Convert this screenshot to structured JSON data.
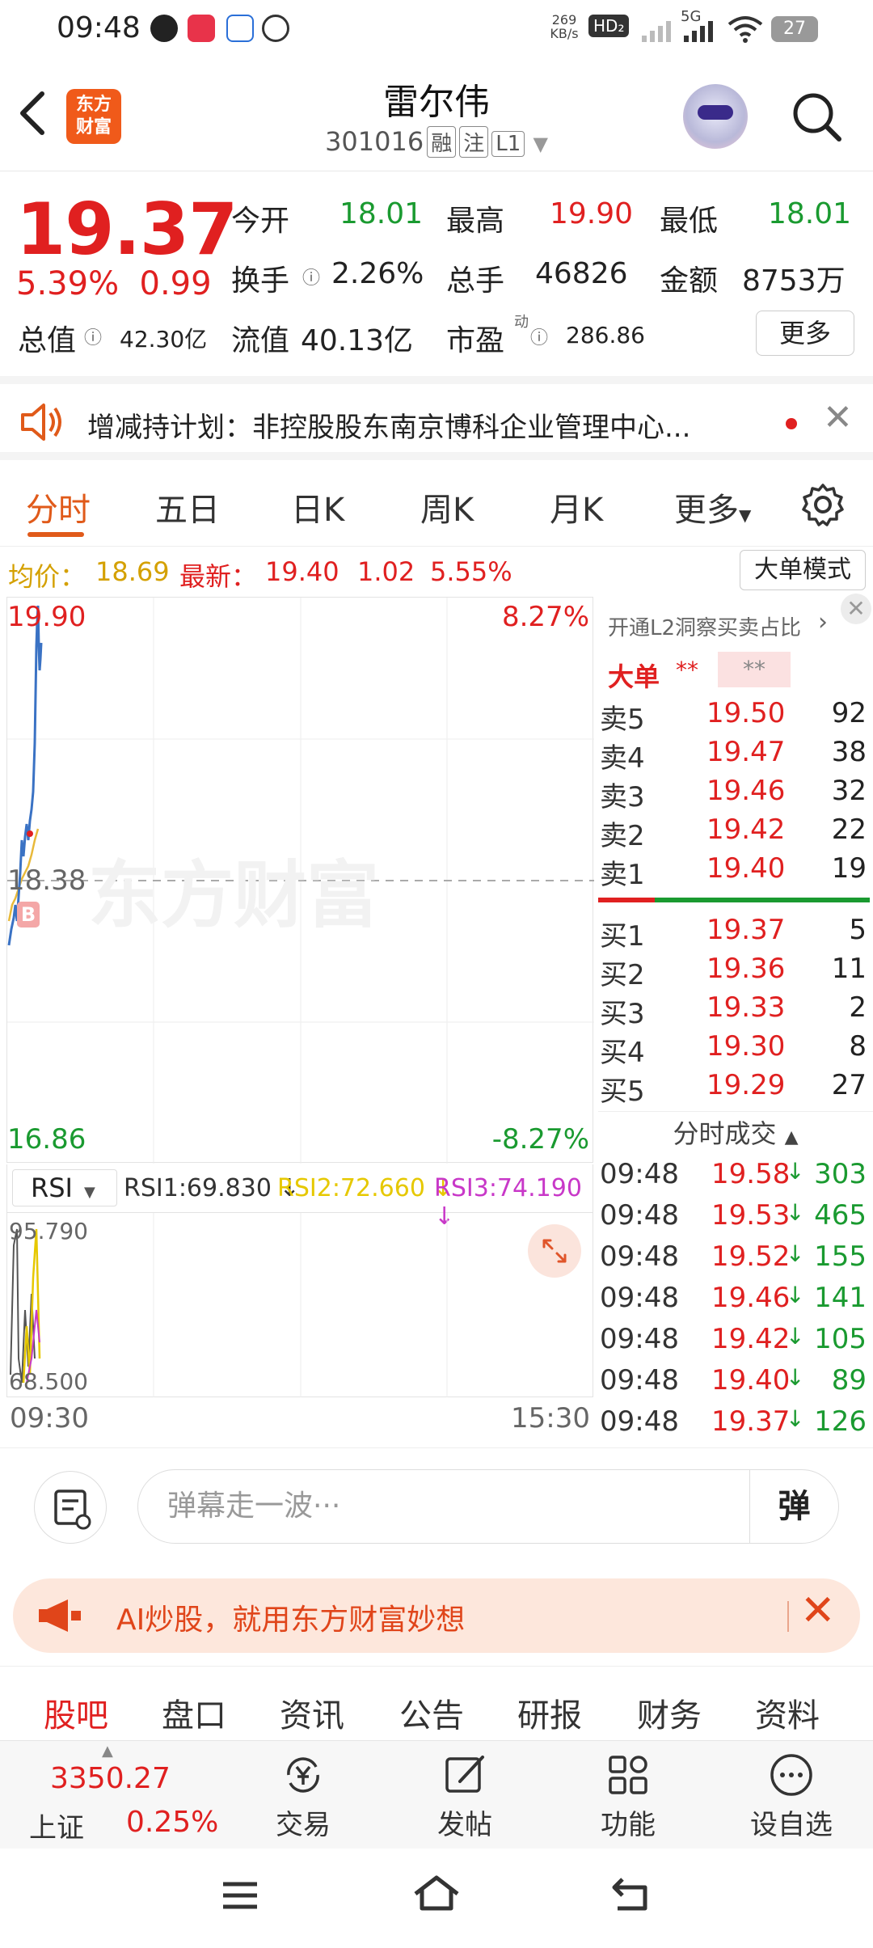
{
  "status": {
    "time": "09:48",
    "net_speed": "269 KB/s",
    "hd": "HD₂",
    "net": "5G",
    "battery": "27"
  },
  "header": {
    "logo_line1": "东方",
    "logo_line2": "财富",
    "name": "雷尔伟",
    "code": "301016",
    "tags": [
      "融",
      "注",
      "L1"
    ]
  },
  "quote": {
    "price": "19.37",
    "pct": "5.39%",
    "chg": "0.99",
    "open_label": "今开",
    "open": "18.01",
    "high_label": "最高",
    "high": "19.90",
    "low_label": "最低",
    "low": "18.01",
    "turnover_label": "换手",
    "turnover": "2.26%",
    "volume_label": "总手",
    "volume": "46826",
    "amount_label": "金额",
    "amount": "8753万",
    "mcap_label": "总值",
    "mcap": "42.30亿",
    "float_label": "流值",
    "float": "40.13亿",
    "pe_label": "市盈",
    "pe_sup": "动",
    "pe": "286.86",
    "more": "更多"
  },
  "notice": {
    "text": "增减持计划：非控股股东南京博科企业管理中心..."
  },
  "chart_tabs": [
    "分时",
    "五日",
    "日K",
    "周K",
    "月K",
    "更多"
  ],
  "avg_row": {
    "avg_label": "均价：",
    "avg": "18.69",
    "latest_label": "最新：",
    "latest": "19.40",
    "chg": "1.02",
    "pct": "5.55%",
    "big_order": "大单模式"
  },
  "chart": {
    "top_price": "19.90",
    "top_pct": "8.27%",
    "mid_price": "18.38",
    "bottom_price": "16.86",
    "bottom_pct": "-8.27%",
    "watermark": "东方财富",
    "buy_marker": "B",
    "rsi_label": "RSI",
    "rsi1": "RSI1:69.830",
    "rsi2": "RSI2:72.660",
    "rsi3": "RSI3:74.190",
    "rsi_top": "95.790",
    "rsi_bottom": "68.500",
    "t_start": "09:30",
    "t_end": "15:30"
  },
  "orderbook": {
    "l2_text": "开通L2洞察买卖占比",
    "big_label": "大单",
    "big_v1": "**",
    "big_v2": "**",
    "sell": [
      {
        "l": "卖5",
        "p": "19.50",
        "v": "92"
      },
      {
        "l": "卖4",
        "p": "19.47",
        "v": "38"
      },
      {
        "l": "卖3",
        "p": "19.46",
        "v": "32"
      },
      {
        "l": "卖2",
        "p": "19.42",
        "v": "22"
      },
      {
        "l": "卖1",
        "p": "19.40",
        "v": "19"
      }
    ],
    "buy": [
      {
        "l": "买1",
        "p": "19.37",
        "v": "5"
      },
      {
        "l": "买2",
        "p": "19.36",
        "v": "11"
      },
      {
        "l": "买3",
        "p": "19.33",
        "v": "2"
      },
      {
        "l": "买4",
        "p": "19.30",
        "v": "8"
      },
      {
        "l": "买5",
        "p": "19.29",
        "v": "27"
      }
    ],
    "trades_title": "分时成交",
    "trades": [
      {
        "t": "09:48",
        "p": "19.58",
        "v": "303"
      },
      {
        "t": "09:48",
        "p": "19.53",
        "v": "465"
      },
      {
        "t": "09:48",
        "p": "19.52",
        "v": "155"
      },
      {
        "t": "09:48",
        "p": "19.46",
        "v": "141"
      },
      {
        "t": "09:48",
        "p": "19.42",
        "v": "105"
      },
      {
        "t": "09:48",
        "p": "19.40",
        "v": "89"
      },
      {
        "t": "09:48",
        "p": "19.37",
        "v": "126"
      }
    ]
  },
  "comment": {
    "placeholder": "弹幕走一波···",
    "send": "弹"
  },
  "ai_banner": {
    "text": "AI炒股，就用东方财富妙想"
  },
  "sub_tabs": [
    "股吧",
    "盘口",
    "资讯",
    "公告",
    "研报",
    "财务",
    "资料"
  ],
  "bottom_nav": {
    "index_value": "3350.27",
    "index_name": "上证",
    "index_pct": "0.25%",
    "items": [
      "交易",
      "发帖",
      "功能",
      "设自选"
    ]
  },
  "colors": {
    "up": "#e02020",
    "down": "#1a9a30",
    "accent": "#e05a1a"
  }
}
